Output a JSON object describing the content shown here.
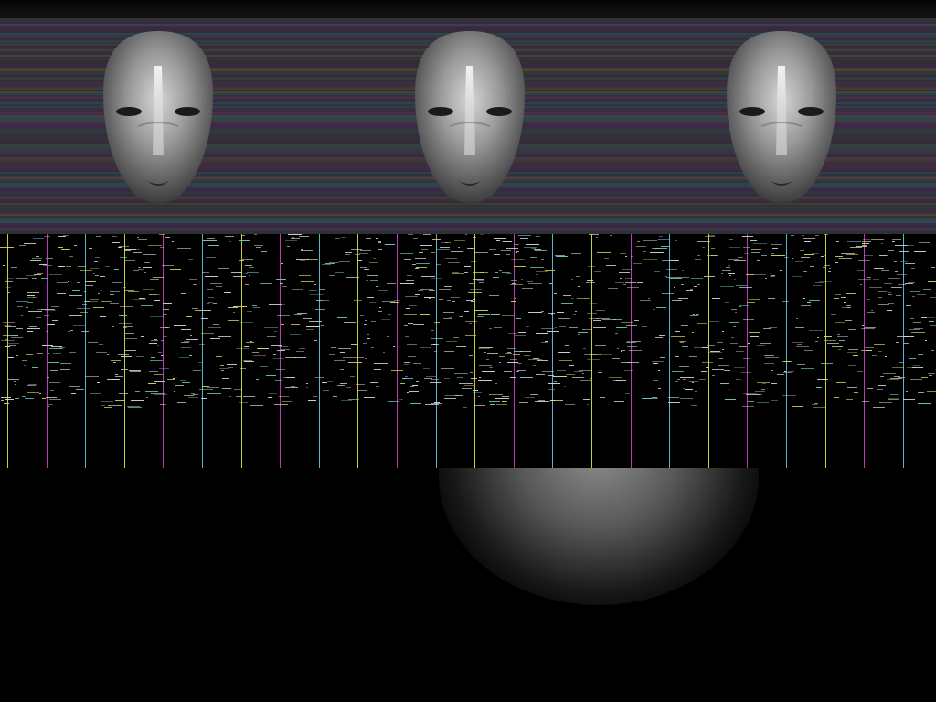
{
  "scene": {
    "mask_count": 3,
    "masks": [
      {
        "name": "mask-left"
      },
      {
        "name": "mask-center"
      },
      {
        "name": "mask-right"
      }
    ],
    "colors": {
      "band_base": "#2e2a33",
      "stripe_palette": [
        "#6a2f6f",
        "#2f5a6a",
        "#5a5a2f",
        "#3a3a3a",
        "#4a2a55",
        "#2a4a4a"
      ],
      "column_palette": [
        "#e0e040",
        "#d040d0",
        "#60c8e0"
      ],
      "mask_light": "#cfcfcf",
      "mask_dark": "#3a3a3a",
      "glow": "#9a9a9a"
    }
  }
}
